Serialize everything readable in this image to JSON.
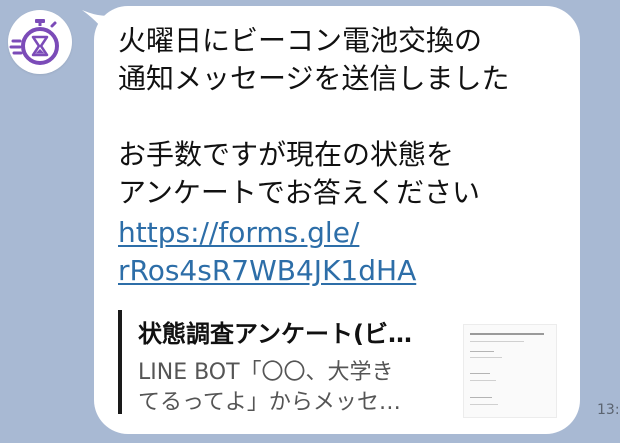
{
  "avatar": {
    "icon": "stopwatch-hourglass-icon",
    "accent": "#7b4bb8"
  },
  "message": {
    "text_line1": "火曜日にビーコン電池交換の",
    "text_line2": "通知メッセージを送信しました",
    "text_line3": "",
    "text_line4": "お手数ですが現在の状態を",
    "text_line5": "アンケートでお答えください",
    "link_line1": "https://forms.gle/",
    "link_line2": "rRos4sR7WB4JK1dHA",
    "link_color": "#2d6ea8"
  },
  "preview": {
    "title": "状態調査アンケート(ビ…",
    "desc_line1": "LINE BOT「〇〇、大学き",
    "desc_line2": "てるってよ」からメッセ…"
  },
  "timestamp": "13:"
}
